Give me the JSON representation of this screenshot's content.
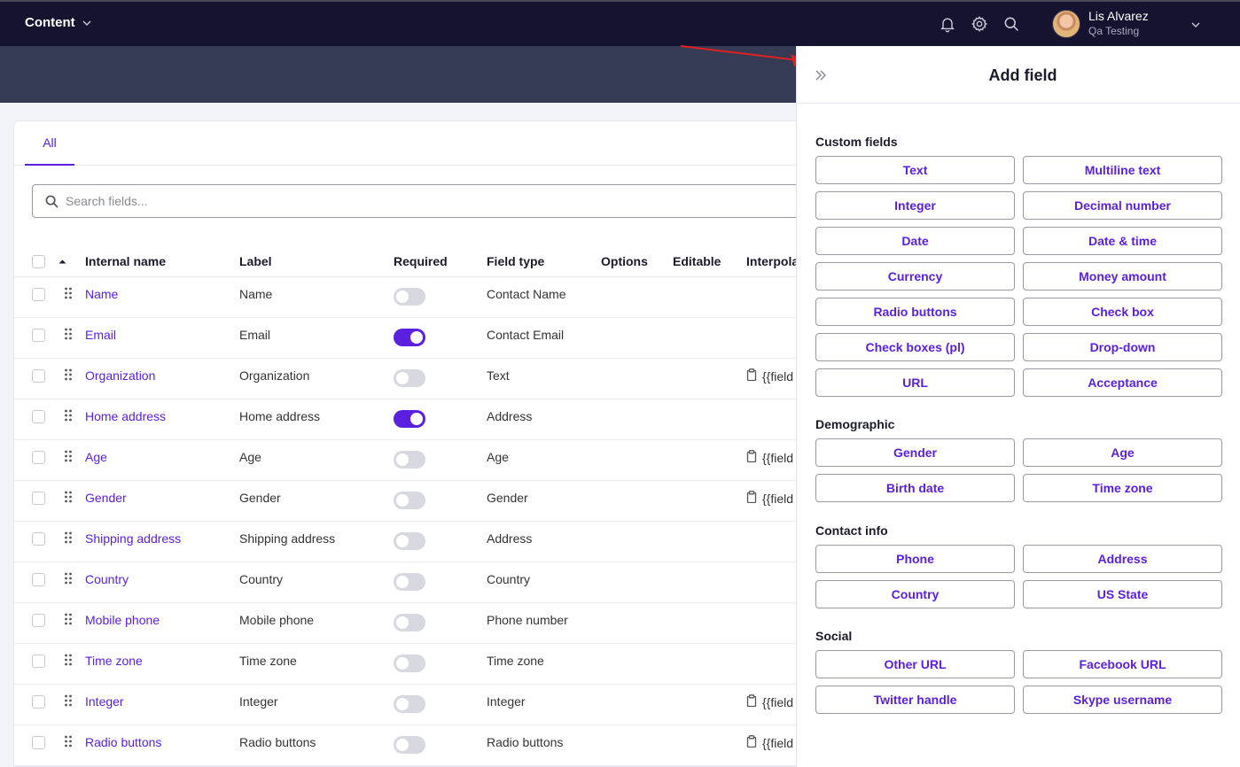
{
  "topbar": {
    "title": "Content",
    "user_name": "Lis Alvarez",
    "user_org": "Qa Testing"
  },
  "tabs": {
    "all": "All"
  },
  "search": {
    "placeholder": "Search fields..."
  },
  "columns": {
    "internal_name": "Internal name",
    "label": "Label",
    "required": "Required",
    "field_type": "Field type",
    "options": "Options",
    "editable": "Editable",
    "interpolation": "Interpola"
  },
  "rows": [
    {
      "internal_name": "Name",
      "label": "Name",
      "required": false,
      "field_type": "Contact Name",
      "interpolation": ""
    },
    {
      "internal_name": "Email",
      "label": "Email",
      "required": true,
      "field_type": "Contact Email",
      "interpolation": ""
    },
    {
      "internal_name": "Organization",
      "label": "Organization",
      "required": false,
      "field_type": "Text",
      "interpolation": "{{field"
    },
    {
      "internal_name": "Home address",
      "label": "Home address",
      "required": true,
      "field_type": "Address",
      "interpolation": ""
    },
    {
      "internal_name": "Age",
      "label": "Age",
      "required": false,
      "field_type": "Age",
      "interpolation": "{{field"
    },
    {
      "internal_name": "Gender",
      "label": "Gender",
      "required": false,
      "field_type": "Gender",
      "interpolation": "{{field"
    },
    {
      "internal_name": "Shipping address",
      "label": "Shipping address",
      "required": false,
      "field_type": "Address",
      "interpolation": ""
    },
    {
      "internal_name": "Country",
      "label": "Country",
      "required": false,
      "field_type": "Country",
      "interpolation": ""
    },
    {
      "internal_name": "Mobile phone",
      "label": "Mobile phone",
      "required": false,
      "field_type": "Phone number",
      "interpolation": ""
    },
    {
      "internal_name": "Time zone",
      "label": "Time zone",
      "required": false,
      "field_type": "Time zone",
      "interpolation": ""
    },
    {
      "internal_name": "Integer",
      "label": "Integer",
      "required": false,
      "field_type": "Integer",
      "interpolation": "{{field"
    },
    {
      "internal_name": "Radio buttons",
      "label": "Radio buttons",
      "required": false,
      "field_type": "Radio buttons",
      "interpolation": "{{field"
    }
  ],
  "panel": {
    "title": "Add field",
    "sections": [
      {
        "title": "Custom fields",
        "buttons": [
          "Text",
          "Multiline text",
          "Integer",
          "Decimal number",
          "Date",
          "Date & time",
          "Currency",
          "Money amount",
          "Radio buttons",
          "Check box",
          "Check boxes (pl)",
          "Drop-down",
          "URL",
          "Acceptance"
        ]
      },
      {
        "title": "Demographic",
        "buttons": [
          "Gender",
          "Age",
          "Birth date",
          "Time zone"
        ]
      },
      {
        "title": "Contact info",
        "buttons": [
          "Phone",
          "Address",
          "Country",
          "US State"
        ]
      },
      {
        "title": "Social",
        "buttons": [
          "Other URL",
          "Facebook URL",
          "Twitter handle",
          "Skype username"
        ]
      }
    ]
  },
  "colors": {
    "accent": "#5b1fe0",
    "topbar": "#15132f",
    "band": "#353a55",
    "annotation_arrow": "#e0221f"
  }
}
